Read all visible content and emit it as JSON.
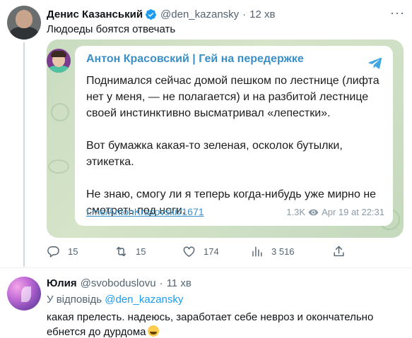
{
  "tweet": {
    "author_name": "Денис Казанський",
    "handle": "@den_kazansky",
    "separator": "·",
    "time": "12 хв",
    "text": "Людоеды боятся отвечать",
    "more": "···",
    "actions": {
      "replies": "15",
      "retweets": "15",
      "likes": "174",
      "views": "3 516"
    }
  },
  "telegram": {
    "channel": "Антон Красовский | Гей на передержке",
    "paragraphs": [
      "Поднимался сейчас домой пешком по лестнице (лифта нет у меня, — не полагается) и на разбитой лестнице своей инстинктивно высматривал «лепестки».",
      "Вот бумажка какая-то зеленая, осколок бутылки, этикетка.",
      "Не знаю, смогу ли я теперь когда-нибудь уже мирно не смотреть под ноги."
    ],
    "link": "t.me/AntonKrasovskii/1671",
    "views": "1.3K",
    "date": "Apr 19 at 22:31"
  },
  "reply": {
    "author_name": "Юлия",
    "handle": "@svoboduslovu",
    "separator": "·",
    "time": "11 хв",
    "reply_to_prefix": "У відповідь",
    "reply_to_handle": "@den_kazansky",
    "text": "какая прелесть. надеюсь, заработает себе невроз и окончательно ебнется до дурдома"
  },
  "colors": {
    "accent": "#1d9bf0",
    "telegram_link": "#3a8fc7",
    "muted": "#536471"
  }
}
